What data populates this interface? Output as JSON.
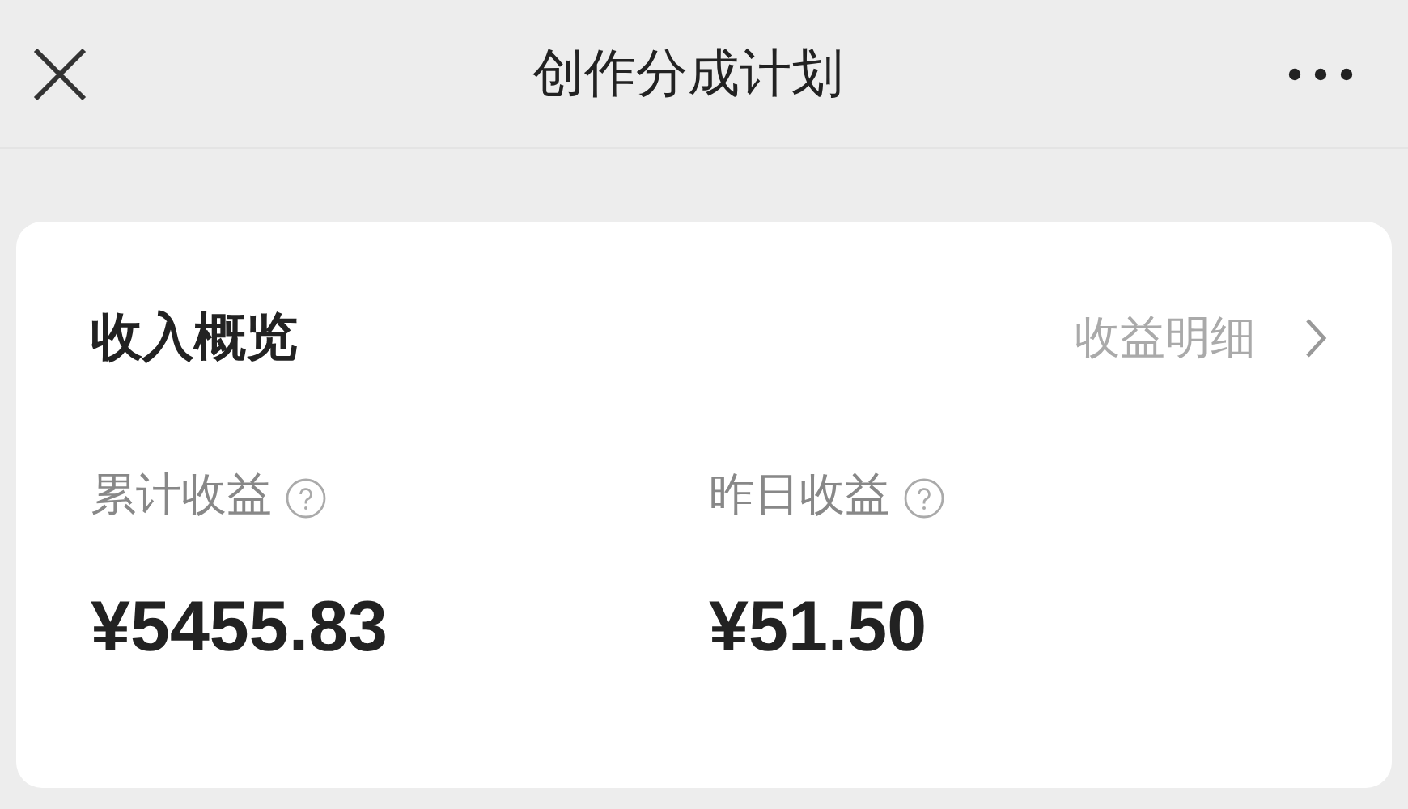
{
  "nav_bar": {
    "title": "创作分成计划"
  },
  "income_overview": {
    "title": "收入概览",
    "detail_link": "收益明细",
    "stats": [
      {
        "label": "累计收益",
        "value": "¥5455.83"
      },
      {
        "label": "昨日收益",
        "value": "¥51.50"
      }
    ]
  }
}
